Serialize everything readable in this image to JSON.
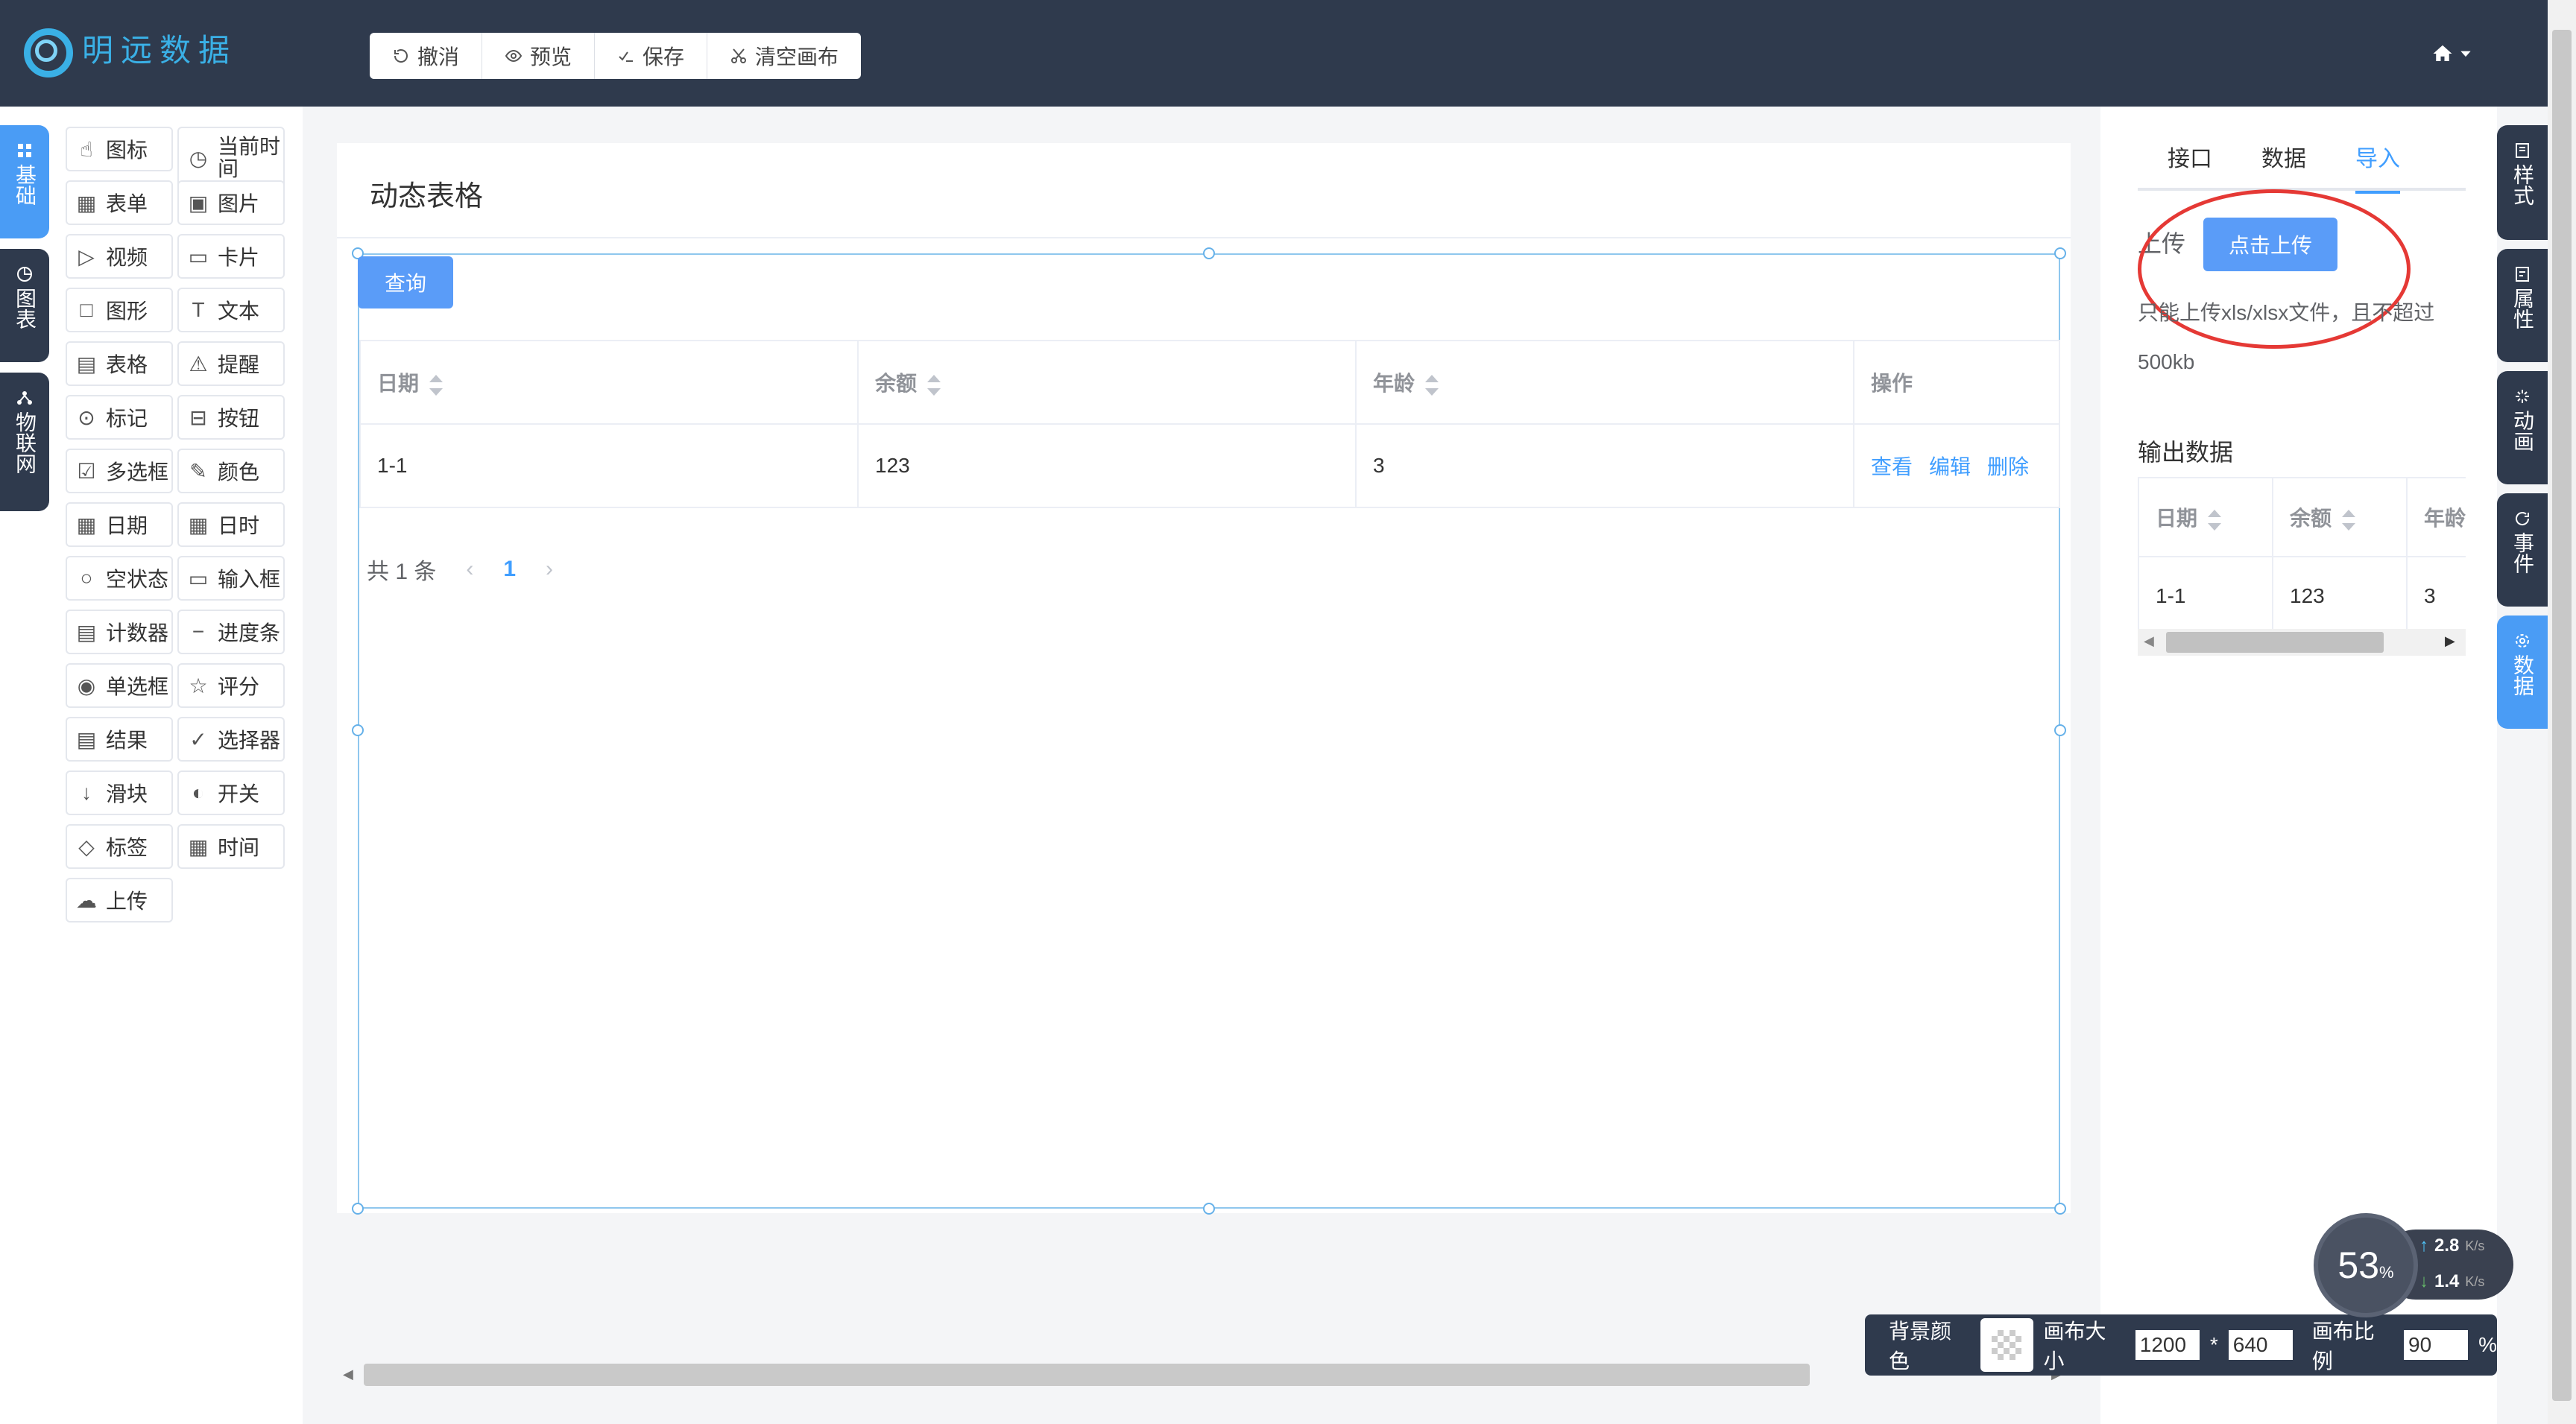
{
  "header": {
    "logo_text": "明远数据",
    "toolbar": [
      {
        "label": "撤消",
        "icon": "undo-icon"
      },
      {
        "label": "预览",
        "icon": "eye-icon"
      },
      {
        "label": "保存",
        "icon": "save-icon"
      },
      {
        "label": "清空画布",
        "icon": "scissors-icon"
      }
    ]
  },
  "left_tabs": [
    {
      "label": "基础",
      "icon": "grid-icon",
      "active": true
    },
    {
      "label": "图表",
      "icon": "pie-chart-icon",
      "active": false
    },
    {
      "label": "物联网",
      "icon": "network-icon",
      "active": false
    }
  ],
  "components": [
    [
      "图标",
      "当前时间"
    ],
    [
      "表单",
      "图片"
    ],
    [
      "视频",
      "卡片"
    ],
    [
      "图形",
      "文本"
    ],
    [
      "表格",
      "提醒"
    ],
    [
      "标记",
      "按钮"
    ],
    [
      "多选框",
      "颜色"
    ],
    [
      "日期",
      "日时"
    ],
    [
      "空状态",
      "输入框"
    ],
    [
      "计数器",
      "进度条"
    ],
    [
      "单选框",
      "评分"
    ],
    [
      "结果",
      "选择器"
    ],
    [
      "滑块",
      "开关"
    ],
    [
      "标签",
      "时间"
    ],
    [
      "上传"
    ]
  ],
  "canvas": {
    "title": "动态表格",
    "query_button": "查询",
    "table": {
      "columns": [
        "日期",
        "余额",
        "年龄",
        "操作"
      ],
      "rows": [
        [
          "1-1",
          "123",
          "3"
        ]
      ],
      "actions": [
        "查看",
        "编辑",
        "删除"
      ]
    },
    "pager": {
      "total": "共 1 条",
      "current": "1"
    }
  },
  "right_panel": {
    "tabs": [
      "接口",
      "数据",
      "导入"
    ],
    "active_tab": "导入",
    "upload_label": "上传",
    "upload_button": "点击上传",
    "tip_line1": "只能上传xls/xlsx文件，且不超过",
    "tip_line2": "500kb",
    "output_title": "输出数据",
    "output_table": {
      "columns": [
        "日期",
        "余额",
        "年龄"
      ],
      "rows": [
        [
          "1-1",
          "123",
          "3"
        ]
      ]
    }
  },
  "right_tabs": [
    "样式",
    "属性",
    "动画",
    "事件",
    "数据"
  ],
  "right_tab_active": "数据",
  "bottom_bar": {
    "bg_label": "背景颜色",
    "size_label": "画布大小",
    "width": "1200",
    "sep": "*",
    "height": "640",
    "ratio_label": "画布比例",
    "ratio": "90",
    "pct": "%"
  },
  "net_widget": {
    "cpu": "53",
    "cpu_unit": "%",
    "up": "2.8",
    "down": "1.4",
    "unit": "K/s"
  },
  "colors": {
    "header": "#2f3a4d",
    "accent": "#409eff",
    "button": "#5a9cf8",
    "annotation": "#e53935"
  }
}
